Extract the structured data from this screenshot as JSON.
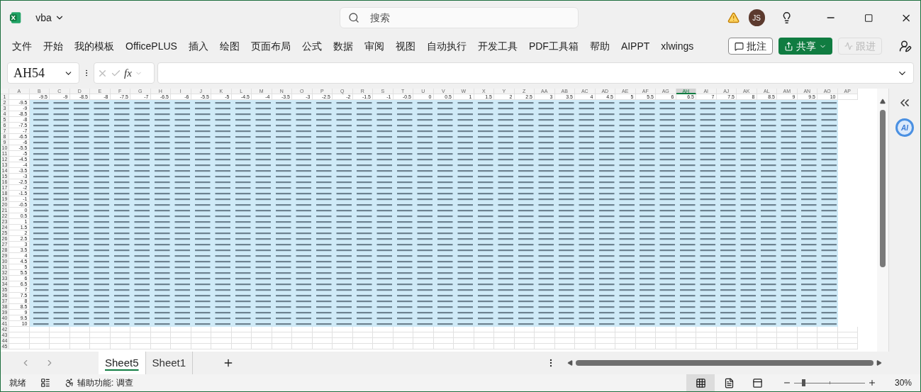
{
  "title_bar": {
    "file_name": "vba",
    "search_placeholder": "搜索",
    "avatar_initials": "JS"
  },
  "ribbon_tabs": [
    "文件",
    "开始",
    "我的模板",
    "OfficePLUS",
    "插入",
    "绘图",
    "页面布局",
    "公式",
    "数据",
    "审阅",
    "视图",
    "自动执行",
    "开发工具",
    "PDF工具箱",
    "帮助",
    "AIPPT",
    "xlwings"
  ],
  "ribbon_actions": [
    {
      "label": "批注",
      "kind": "comment"
    },
    {
      "label": "共享",
      "kind": "share"
    },
    {
      "label": "跟进",
      "kind": "follow",
      "disabled": true
    }
  ],
  "formula_bar": {
    "name_box": "AH54",
    "function_label": "fx"
  },
  "sheet": {
    "columns": [
      {
        "label": "A",
        "selected": false
      },
      {
        "label": "B",
        "selected": false
      },
      {
        "label": "C",
        "selected": false
      },
      {
        "label": "D",
        "selected": false
      },
      {
        "label": "E",
        "selected": false
      },
      {
        "label": "F",
        "selected": false
      },
      {
        "label": "G",
        "selected": false
      },
      {
        "label": "H",
        "selected": false
      },
      {
        "label": "I",
        "selected": false
      },
      {
        "label": "J",
        "selected": false
      },
      {
        "label": "K",
        "selected": false
      },
      {
        "label": "L",
        "selected": false
      },
      {
        "label": "M",
        "selected": false
      },
      {
        "label": "N",
        "selected": false
      },
      {
        "label": "O",
        "selected": false
      },
      {
        "label": "P",
        "selected": false
      },
      {
        "label": "Q",
        "selected": false
      },
      {
        "label": "R",
        "selected": false
      },
      {
        "label": "S",
        "selected": false
      },
      {
        "label": "T",
        "selected": false
      },
      {
        "label": "U",
        "selected": false
      },
      {
        "label": "V",
        "selected": false
      },
      {
        "label": "W",
        "selected": false
      },
      {
        "label": "X",
        "selected": false
      },
      {
        "label": "Y",
        "selected": false
      },
      {
        "label": "Z",
        "selected": false
      },
      {
        "label": "AA",
        "selected": false
      },
      {
        "label": "AB",
        "selected": false
      },
      {
        "label": "AC",
        "selected": false
      },
      {
        "label": "AD",
        "selected": false
      },
      {
        "label": "AE",
        "selected": false
      },
      {
        "label": "AF",
        "selected": false
      },
      {
        "label": "AG",
        "selected": false
      },
      {
        "label": "AH",
        "selected": true
      },
      {
        "label": "AI",
        "selected": false
      },
      {
        "label": "AJ",
        "selected": false
      },
      {
        "label": "AK",
        "selected": false
      },
      {
        "label": "AL",
        "selected": false
      },
      {
        "label": "AM",
        "selected": false
      },
      {
        "label": "AN",
        "selected": false
      },
      {
        "label": "AO",
        "selected": false
      },
      {
        "label": "AP",
        "selected": false
      }
    ],
    "header_row": {
      "number": "1",
      "values": [
        "-9.5",
        "-9",
        "-8.5",
        "-8",
        "-7.5",
        "-7",
        "-6.5",
        "-6",
        "-5.5",
        "-5",
        "-4.5",
        "-4",
        "-3.5",
        "-3",
        "-2.5",
        "-2",
        "-1.5",
        "-1",
        "-0.5",
        "0",
        "0.5",
        "1",
        "1.5",
        "2",
        "2.5",
        "3",
        "3.5",
        "4",
        "4.5",
        "5",
        "5.5",
        "6",
        "6.5",
        "7",
        "7.5",
        "8",
        "8.5",
        "9",
        "9.5",
        "10"
      ]
    },
    "data_rows": [
      {
        "number": "2",
        "label": "-9.5"
      },
      {
        "number": "3",
        "label": "-9"
      },
      {
        "number": "4",
        "label": "-8.5"
      },
      {
        "number": "5",
        "label": "-8"
      },
      {
        "number": "6",
        "label": "-7.5"
      },
      {
        "number": "7",
        "label": "-7"
      },
      {
        "number": "8",
        "label": "-6.5"
      },
      {
        "number": "9",
        "label": "-6"
      },
      {
        "number": "10",
        "label": "-5.5"
      },
      {
        "number": "11",
        "label": "-5"
      },
      {
        "number": "12",
        "label": "-4.5"
      },
      {
        "number": "13",
        "label": "-4"
      },
      {
        "number": "14",
        "label": "-3.5"
      },
      {
        "number": "15",
        "label": "-3"
      },
      {
        "number": "16",
        "label": "-2.5"
      },
      {
        "number": "17",
        "label": "-2"
      },
      {
        "number": "18",
        "label": "-1.5"
      },
      {
        "number": "19",
        "label": "-1"
      },
      {
        "number": "20",
        "label": "-0.5"
      },
      {
        "number": "21",
        "label": "0"
      },
      {
        "number": "22",
        "label": "0.5"
      },
      {
        "number": "23",
        "label": "1"
      },
      {
        "number": "24",
        "label": "1.5"
      },
      {
        "number": "25",
        "label": "2"
      },
      {
        "number": "26",
        "label": "2.5"
      },
      {
        "number": "27",
        "label": "3"
      },
      {
        "number": "28",
        "label": "3.5"
      },
      {
        "number": "29",
        "label": "4"
      },
      {
        "number": "30",
        "label": "4.5"
      },
      {
        "number": "31",
        "label": "5"
      },
      {
        "number": "32",
        "label": "5.5"
      },
      {
        "number": "33",
        "label": "6"
      },
      {
        "number": "34",
        "label": "6.5"
      },
      {
        "number": "35",
        "label": "7"
      },
      {
        "number": "36",
        "label": "7.5"
      },
      {
        "number": "37",
        "label": "8"
      },
      {
        "number": "38",
        "label": "8.5"
      },
      {
        "number": "39",
        "label": "9"
      },
      {
        "number": "40",
        "label": "9.5"
      },
      {
        "number": "41",
        "label": "10"
      }
    ],
    "empty_rows": [
      "42",
      "43",
      "44",
      "45"
    ]
  },
  "side_panel": {
    "ai_label": "AI"
  },
  "sheet_tabs": [
    {
      "label": "Sheet5",
      "selected": true
    },
    {
      "label": "Sheet1",
      "selected": false
    }
  ],
  "status_bar": {
    "ready": "就绪",
    "accessibility": "辅助功能: 调查",
    "views": [
      {
        "kind": "normal",
        "selected": true
      },
      {
        "kind": "page_layout",
        "selected": false
      },
      {
        "kind": "page_break",
        "selected": false
      }
    ],
    "zoom": {
      "level": 0.13,
      "reading": "30%"
    }
  }
}
